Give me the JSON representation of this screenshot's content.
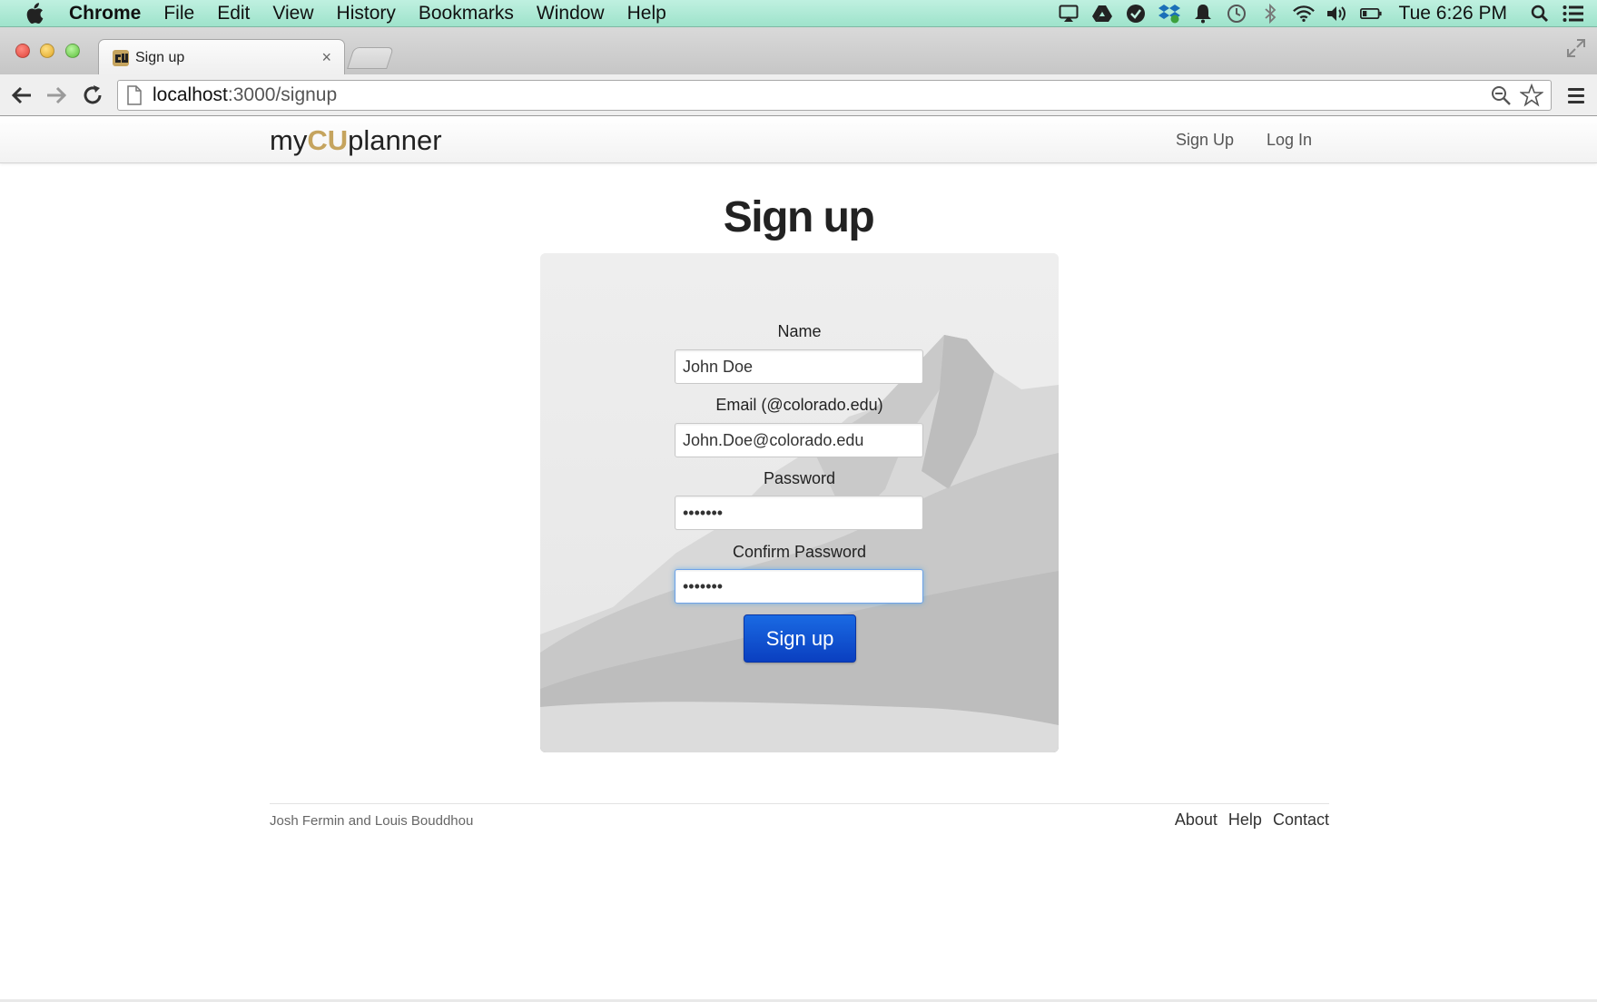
{
  "menubar": {
    "app_name": "Chrome",
    "items": [
      "File",
      "Edit",
      "View",
      "History",
      "Bookmarks",
      "Window",
      "Help"
    ],
    "clock": "Tue 6:26 PM",
    "status_icons": [
      "airplay-icon",
      "google-drive-icon",
      "evernote-icon",
      "dropbox-icon",
      "notification-icon",
      "time-machine-icon",
      "bluetooth-icon",
      "wifi-icon",
      "volume-icon",
      "battery-icon",
      "spotlight-icon",
      "notification-center-icon"
    ]
  },
  "browser": {
    "tab_title": "Sign up",
    "tab_close": "×",
    "url_host": "localhost",
    "url_path": ":3000/signup"
  },
  "navbar": {
    "brand_prefix": "my",
    "brand_highlight": "CU",
    "brand_suffix": "planner",
    "brand_color": "#c5a45e",
    "links": [
      "Sign Up",
      "Log In"
    ]
  },
  "page": {
    "title": "Sign up"
  },
  "form": {
    "fields": [
      {
        "label": "Name",
        "value": "John Doe",
        "type": "text"
      },
      {
        "label": "Email (@colorado.edu)",
        "value": "John.Doe@colorado.edu",
        "type": "email"
      },
      {
        "label": "Password",
        "value": "•••••••",
        "type": "password"
      },
      {
        "label": "Confirm Password",
        "value": "•••••••",
        "type": "password"
      }
    ],
    "submit_label": "Sign up",
    "submit_color": "#0a4fd0"
  },
  "footer": {
    "credit": "Josh Fermin and Louis Bouddhou",
    "links": [
      "About",
      "Help",
      "Contact"
    ]
  }
}
